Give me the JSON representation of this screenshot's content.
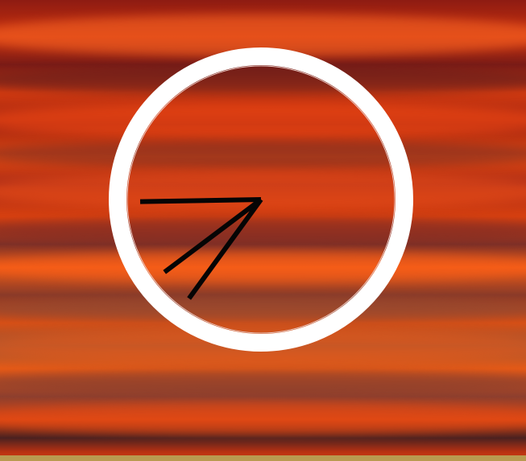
{
  "desktop": {
    "wallpaper": {
      "subject": "sunset-sky",
      "colors": {
        "deep_red": "#7a1b16",
        "orange_red": "#e8490e",
        "burnt_brown": "#8a3a28",
        "bottom_strip": "#b99a50"
      }
    }
  },
  "analog_clock": {
    "colors": {
      "ring": "#ffffff",
      "hands": "#050505"
    },
    "time_shown": {
      "hour_hand_angle_deg": 269,
      "minute_hand_angle_deg": 216,
      "second_hand_angle_deg": 233
    },
    "numerals_visible": false
  }
}
